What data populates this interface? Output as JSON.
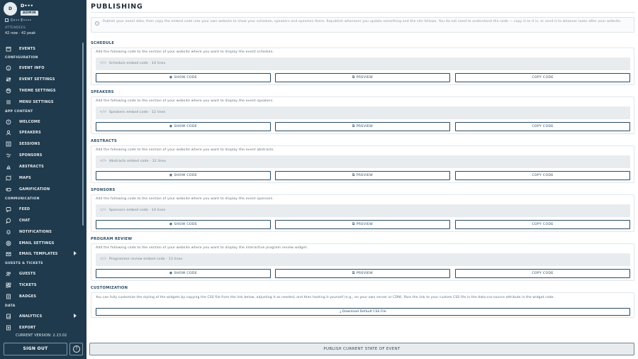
{
  "sidebar": {
    "user": {
      "initial": "D",
      "name": "D•••",
      "role": "ADMIN"
    },
    "org": "D••• E••••",
    "attendees": {
      "label": "ATTENDEES",
      "value": "42 now · 42 peak"
    },
    "sections": {
      "configuration": "CONFIGURATION",
      "app_content": "APP CONTENT",
      "communication": "COMMUNICATION",
      "guests_tickets": "GUESTS & TICKETS",
      "data": "DATA"
    },
    "items": {
      "events": "EVENTS",
      "event_info": "EVENT INFO",
      "event_settings": "EVENT SETTINGS",
      "theme_settings": "THEME SETTINGS",
      "menu_settings": "MENU SETTINGS",
      "welcome": "WELCOME",
      "speakers": "SPEAKERS",
      "sessions": "SESSIONS",
      "sponsors": "SPONSORS",
      "abstracts": "ABSTRACTS",
      "maps": "MAPS",
      "gamification": "GAMIFICATION",
      "feed": "FEED",
      "chat": "CHAT",
      "notifications": "NOTIFICATIONS",
      "email_settings": "EMAIL SETTINGS",
      "email_templates": "EMAIL TEMPLATES",
      "guests": "GUESTS",
      "tickets": "TICKETS",
      "badges": "BADGES",
      "analytics": "ANALYTICS",
      "export": "EXPORT"
    },
    "version": "CURRENT VERSION: 2.23.02",
    "signout": "SIGN OUT",
    "help": "?"
  },
  "main": {
    "title": "PUBLISHING",
    "info": "Publish your event data, then copy the embed code into your own website to show your schedule, speakers and sponsors there. Republish whenever you update something and the site follows. You do not need to understand the code — copy it as it is, or send it to whoever looks after your website.",
    "buttons": {
      "show": "SHOW CODE",
      "preview": "PREVIEW",
      "copy": "COPY CODE"
    },
    "sections": {
      "schedule": {
        "title": "SCHEDULE",
        "desc": "Add the following code to the section of your website where you want to display the event schedule.",
        "code": "Schedule embed code · 14 lines"
      },
      "speakers": {
        "title": "SPEAKERS",
        "desc": "Add the following code to the section of your website where you want to display the event speakers.",
        "code": "Speakers embed code · 12 lines"
      },
      "abstracts": {
        "title": "ABSTRACTS",
        "desc": "Add the following code to the section of your website where you want to display the event abstracts.",
        "code": "Abstracts embed code · 12 lines"
      },
      "sponsors": {
        "title": "SPONSORS",
        "desc": "Add the following code to the section of your website where you want to display the event sponsors.",
        "code": "Sponsors embed code · 14 lines"
      },
      "program_review": {
        "title": "PROGRAM REVIEW",
        "desc": "Add the following code to the section of your website where you want to display the interactive program review widget.",
        "code": "Programme review embed code · 13 lines"
      }
    },
    "customization": {
      "title": "CUSTOMIZATION",
      "text": "You can fully customize the styling of the widgets by copying the CSS file from the link below, adjusting it as needed, and then hosting it yourself (e.g., on your own server or CDN). Pass the link to your custom CSS file in the data-css-source attribute in the widget code.",
      "download": "Download Default CSS File"
    },
    "publish": "PUBLISH CURRENT STATE OF EVENT"
  }
}
